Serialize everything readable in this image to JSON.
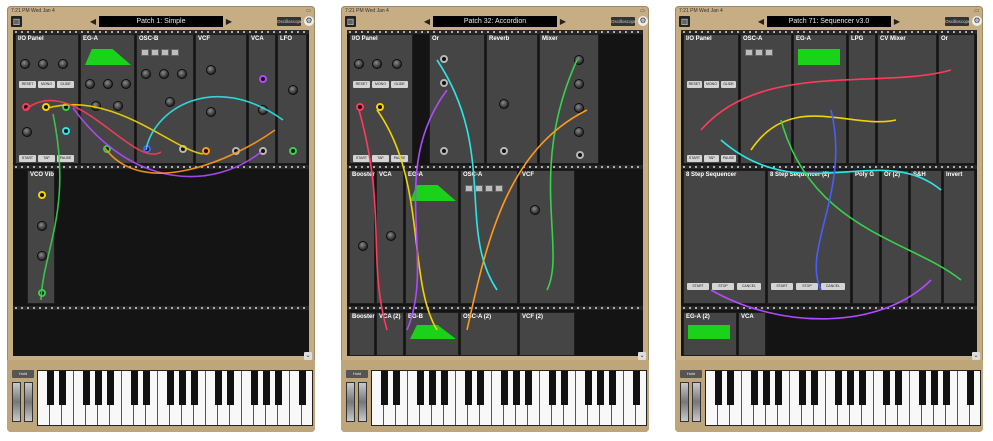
{
  "screens": [
    {
      "status_left": "7:21 PM  Wed Jan 4",
      "patch_title": "Patch 1: Simple",
      "osc_label": "Oscilloscope",
      "modules": [
        "I/O Panel",
        "EG-A",
        "OSC-B",
        "VCF",
        "VCA",
        "LFO",
        "VCO Vib"
      ],
      "io_buttons": [
        "RESET",
        "MONO",
        "GLIDE",
        "START",
        "TAP",
        "PAUSE"
      ],
      "hold_label": "Hold"
    },
    {
      "status_left": "7:21 PM  Wed Jan 4",
      "patch_title": "Patch 32: Accordion",
      "osc_label": "Oscilloscope",
      "modules": [
        "I/O Panel",
        "Or",
        "Reverb",
        "Mixer",
        "Booster",
        "VCA",
        "EG-A",
        "OSC-A",
        "VCF",
        "Booster (2)",
        "VCA (2)",
        "EG-B",
        "OSC-A (2)",
        "VCF (2)"
      ],
      "io_buttons": [
        "RESET",
        "MONO",
        "GLIDE",
        "START",
        "TAP",
        "PAUSE"
      ],
      "hold_label": "Hold"
    },
    {
      "status_left": "7:21 PM  Wed Jan 4",
      "patch_title": "Patch 71: Sequencer v3.0",
      "osc_label": "Oscilloscope",
      "modules": [
        "I/O Panel",
        "OSC-A",
        "EG-A",
        "LPG",
        "CV Mixer",
        "Or",
        "8 Step Sequencer",
        "8 Step Sequencer (2)",
        "Poly G",
        "Or (2)",
        "S&H",
        "Invert",
        "EG-A (2)",
        "VCA"
      ],
      "io_buttons": [
        "RESET",
        "MONO",
        "GLIDE",
        "START",
        "TAP",
        "PAUSE"
      ],
      "seq_buttons": [
        "START",
        "STOP",
        "CANCEL"
      ],
      "hold_label": "Hold"
    }
  ],
  "colors": {
    "frame": "#c6ad83",
    "rack": "#141414",
    "module": "#454545",
    "envelope": "#19d219"
  },
  "icons": [
    "rack-icon",
    "prev-arrow-icon",
    "next-arrow-icon",
    "settings-icon",
    "collapse-chevron-icon"
  ]
}
